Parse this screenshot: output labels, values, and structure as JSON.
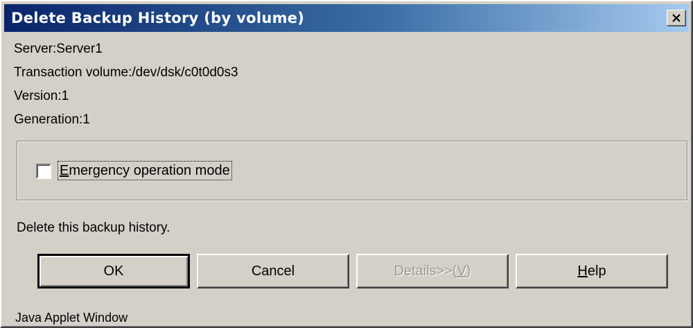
{
  "dialog": {
    "title": "Delete Backup History (by volume)",
    "close_symbol": "×"
  },
  "info": {
    "server": "Server:Server1",
    "transaction_volume": "Transaction volume:/dev/dsk/c0t0d0s3",
    "version": "Version:1",
    "generation": "Generation:1"
  },
  "options": {
    "emergency_mode": {
      "label_mnemonic": "E",
      "label_rest": "mergency operation mode",
      "checked": false
    }
  },
  "message": "Delete this backup history.",
  "buttons": {
    "ok": "OK",
    "cancel": "Cancel",
    "details_prefix": "Details>>(",
    "details_mnemonic": "V",
    "details_suffix": ")",
    "help_mnemonic": "H",
    "help_rest": "elp"
  },
  "footer": "Java Applet Window",
  "icons": {
    "close": "close-icon",
    "checkbox": "checkbox-unchecked-icon"
  }
}
